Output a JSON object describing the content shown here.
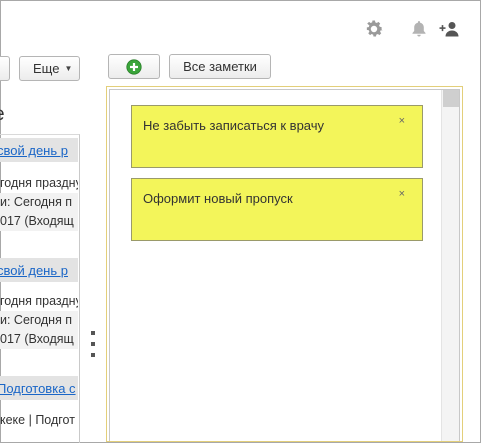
{
  "left": {
    "more_button": "Еще",
    "title": "е",
    "items": [
      {
        "link": "свой день р",
        "lines": [
          "годня праздну",
          "и: Сегодня п",
          "017 (Входящ"
        ]
      },
      {
        "link": "свой день р",
        "lines": [
          "годня праздну",
          "и: Сегодня п",
          "017 (Входящ"
        ]
      },
      {
        "link": "Подготовка с",
        "lines": [
          "кеке | Подгот"
        ]
      }
    ]
  },
  "toolbar": {
    "all_notes": "Все заметки"
  },
  "notes": [
    {
      "text": "Не забыть записаться к врачу",
      "close": "×"
    },
    {
      "text": "Оформит новый пропуск",
      "close": "×"
    }
  ],
  "colors": {
    "note_bg": "#f3f55a",
    "link": "#1a66c7",
    "add_icon": "#3aa53a"
  },
  "icons": [
    "gear-icon",
    "bell-icon",
    "add-user-icon",
    "plus-circle-icon",
    "chevron-down-icon",
    "close-icon"
  ]
}
